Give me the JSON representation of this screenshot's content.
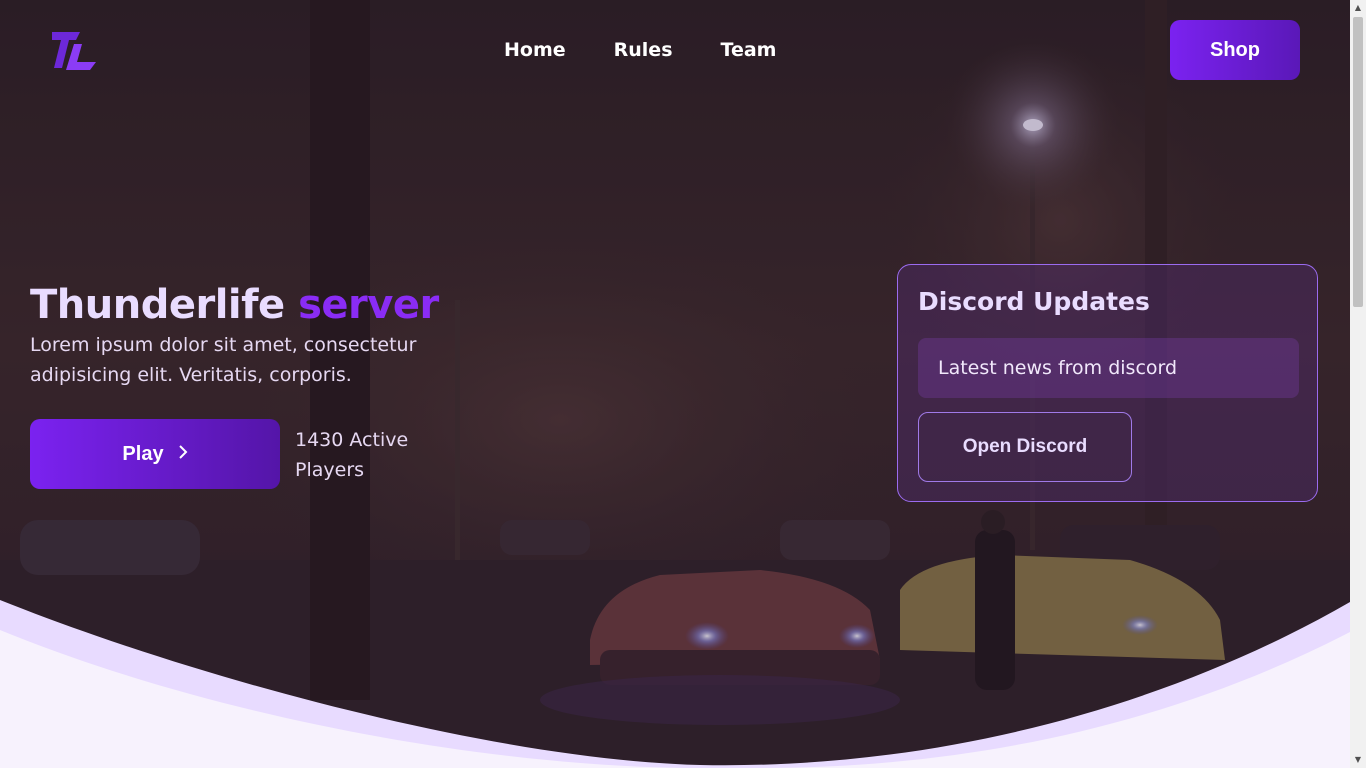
{
  "nav": {
    "logo_icon": "thunderlife-logo-icon",
    "items": [
      {
        "label": "Home"
      },
      {
        "label": "Rules"
      },
      {
        "label": "Team"
      }
    ],
    "shop_label": "Shop"
  },
  "hero": {
    "title_main": "Thunderlife",
    "title_accent": "server",
    "description": "Lorem ipsum dolor sit amet, consectetur adipisicing elit. Veritatis, corporis.",
    "play_label": "Play",
    "play_icon": "chevron-right-icon",
    "active_players": "1430 Active Players"
  },
  "discord": {
    "title": "Discord Updates",
    "news_text": "Latest news from discord",
    "button_label": "Open Discord"
  },
  "colors": {
    "accent": "#7b22f0",
    "accent_dark": "#5415a8",
    "title_text": "#e9dcff",
    "card_border": "#9b6bf0",
    "wave_light": "#e8dbff",
    "wave_lighter": "#f7f2fd"
  },
  "scrollbar": {
    "up_icon": "scroll-up-arrow-icon",
    "down_icon": "scroll-down-arrow-icon"
  }
}
